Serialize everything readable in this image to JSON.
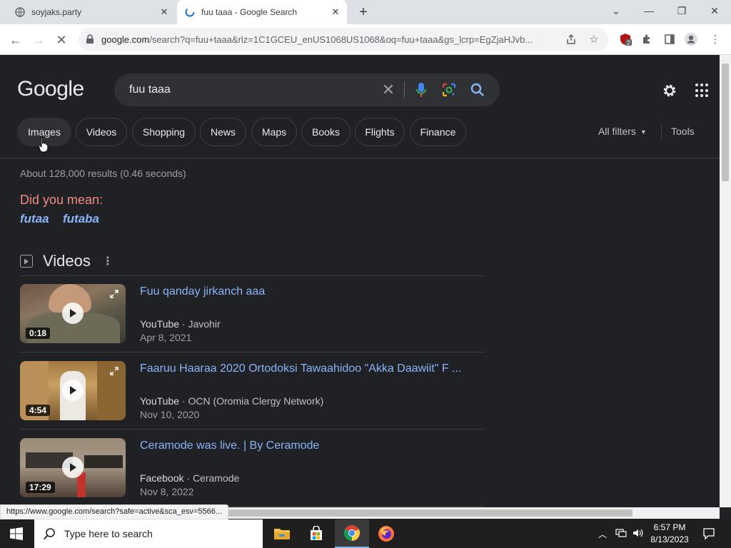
{
  "browser": {
    "tabs": [
      {
        "title": "soyjaks.party"
      },
      {
        "title": "fuu taaa - Google Search"
      }
    ],
    "url_host": "google.com",
    "url_path": "/search?q=fuu+taaa&rlz=1C1GCEU_enUS1068US1068&oq=fuu+taaa&gs_lcrp=EgZjaHJvb...",
    "extension_badge": "2",
    "status_url": "https://www.google.com/search?safe=active&sca_esv=5566..."
  },
  "google": {
    "logo": "Google",
    "query": "fuu taaa",
    "chips": [
      "Images",
      "Videos",
      "Shopping",
      "News",
      "Maps",
      "Books",
      "Flights",
      "Finance"
    ],
    "all_filters": "All filters",
    "tools": "Tools",
    "stats": "About 128,000 results (0.46 seconds)",
    "did_you_mean": "Did you mean:",
    "suggestions": [
      "futaa",
      "futaba"
    ],
    "videos_heading": "Videos",
    "videos": [
      {
        "title": "Fuu qanday jirkanch aaa",
        "source": "YouTube",
        "author": "Javohir",
        "date": "Apr 8, 2021",
        "duration": "0:18",
        "thumb_color": "#5a4a3a"
      },
      {
        "title": "Faaruu Haaraa 2020 Ortodoksi Tawaahidoo \"Akka Daawiit\" F ...",
        "source": "YouTube",
        "author": "OCN (Oromia Clergy Network)",
        "date": "Nov 10, 2020",
        "duration": "4:54",
        "thumb_color": "#8a6a3a"
      },
      {
        "title": "Ceramode was live. | By Ceramode",
        "source": "Facebook",
        "author": "Ceramode",
        "date": "Nov 8, 2022",
        "duration": "17:29",
        "thumb_color": "#7a6a5a"
      }
    ]
  },
  "taskbar": {
    "search_placeholder": "Type here to search",
    "time": "6:57 PM",
    "date": "8/13/2023"
  },
  "colors": {
    "background": "#202124",
    "link": "#8ab4f8",
    "did_you_mean": "#f28b82"
  }
}
